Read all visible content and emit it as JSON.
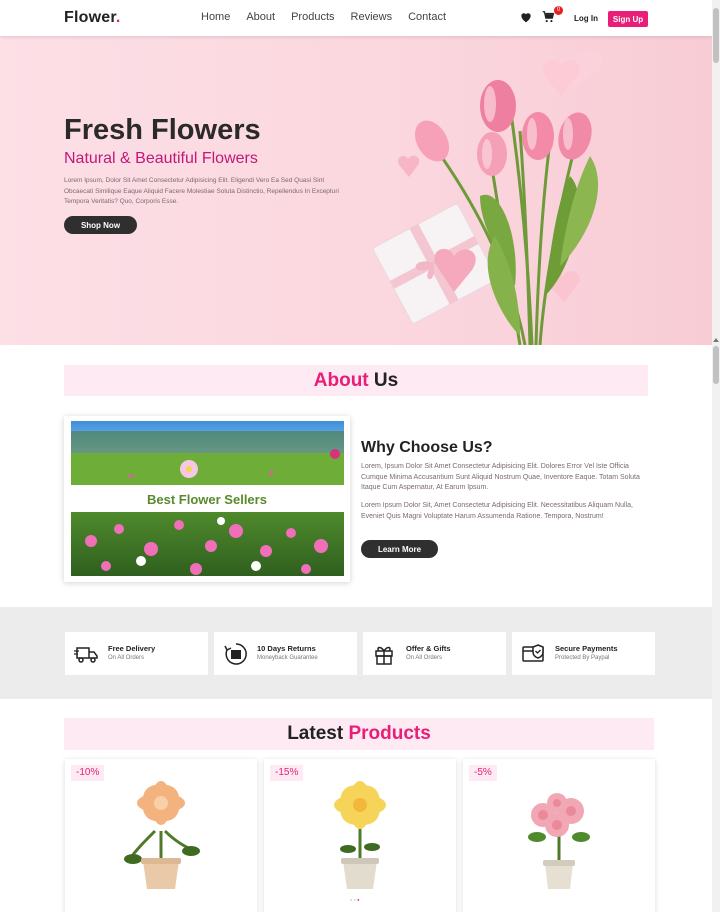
{
  "nav": {
    "logo": "Flower",
    "logo_dot": ".",
    "links": [
      "Home",
      "About",
      "Products",
      "Reviews",
      "Contact"
    ],
    "cart_count": "0",
    "login": "Log In",
    "signup": "Sign Up"
  },
  "hero": {
    "title": "Fresh Flowers",
    "subtitle": "Natural & Beautiful Flowers",
    "text": "Lorem Ipsum, Dolor Sit Amet Consectetur Adipisicing Elit. Eligendi Vero Ea Sed Quasi Sint Obcaecati Similique Eaque Aliquid Facere Molestiae Soluta Distinctio, Repellendus In Excepturi Tempora Veritatis? Quo, Corporis Esse.",
    "button": "Shop Now"
  },
  "about": {
    "heading_highlight": "About",
    "heading_rest": "Us",
    "image_caption": "Best Flower Sellers",
    "why_title": "Why Choose Us?",
    "p1": "Lorem, Ipsum Dolor Sit Amet Consectetur Adipisicing Elit. Dolores Error Vel Iste Officia Cumque Minima Accusantium Sunt Aliquid Nostrum Quae, Inventore Eaque. Totam Soluta Itaque Cum Aspernatur, At Earum Ipsum.",
    "p2": "Lorem Ipsum Dolor Sit, Amet Consectetur Adipisicing Elit. Necessitatibus Aliquam Nulla, Eveniet Quis Magni Voluptate Harum Assumenda Ratione. Tempora, Nostrum!",
    "button": "Learn More"
  },
  "features": [
    {
      "title": "Free Delivery",
      "sub": "On All Orders",
      "icon": "truck-icon"
    },
    {
      "title": "10 Days Returns",
      "sub": "Moneyback Guarantee",
      "icon": "return-box-icon"
    },
    {
      "title": "Offer & Gifts",
      "sub": "On All Orders",
      "icon": "gift-icon"
    },
    {
      "title": "Secure Payments",
      "sub": "Protected By Paypal",
      "icon": "secure-card-icon"
    }
  ],
  "products": {
    "heading_rest": "Latest",
    "heading_highlight": "Products",
    "items": [
      {
        "discount": "-10%"
      },
      {
        "discount": "-15%"
      },
      {
        "discount": "-5%"
      }
    ]
  },
  "colors": {
    "accent": "#e91e78",
    "hero_bg": "#fbd7df",
    "banner_bg": "#fdeaf3",
    "button_dark": "#2f2f2f"
  }
}
